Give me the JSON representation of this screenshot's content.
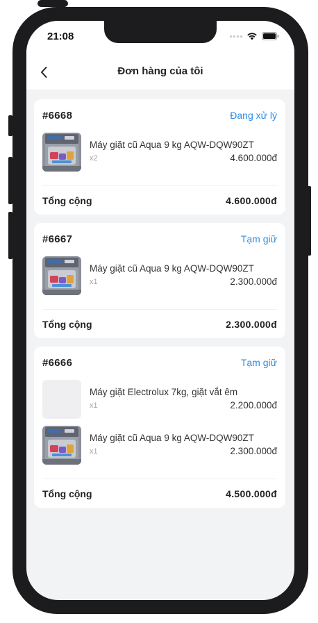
{
  "status_bar": {
    "time": "21:08"
  },
  "header": {
    "title": "Đơn hàng của tôi"
  },
  "labels": {
    "total": "Tổng cộng"
  },
  "colors": {
    "accent": "#2b8be6",
    "background": "#f2f3f5"
  },
  "orders": [
    {
      "id": "#6668",
      "status": "Đang xử lý",
      "items": [
        {
          "name": "Máy giặt cũ Aqua 9 kg AQW-DQW90ZT",
          "qty": "x2",
          "price": "4.600.000đ",
          "image": "washing-machine-photo"
        }
      ],
      "total": "4.600.000đ"
    },
    {
      "id": "#6667",
      "status": "Tạm giữ",
      "items": [
        {
          "name": "Máy giặt cũ Aqua 9 kg AQW-DQW90ZT",
          "qty": "x1",
          "price": "2.300.000đ",
          "image": "washing-machine-photo"
        }
      ],
      "total": "2.300.000đ"
    },
    {
      "id": "#6666",
      "status": "Tạm giữ",
      "items": [
        {
          "name": "Máy giặt Electrolux 7kg, giặt vắt êm",
          "qty": "x1",
          "price": "2.200.000đ",
          "image": "image-placeholder"
        },
        {
          "name": "Máy giặt cũ Aqua 9 kg AQW-DQW90ZT",
          "qty": "x1",
          "price": "2.300.000đ",
          "image": "washing-machine-photo"
        }
      ],
      "total": "4.500.000đ"
    }
  ]
}
